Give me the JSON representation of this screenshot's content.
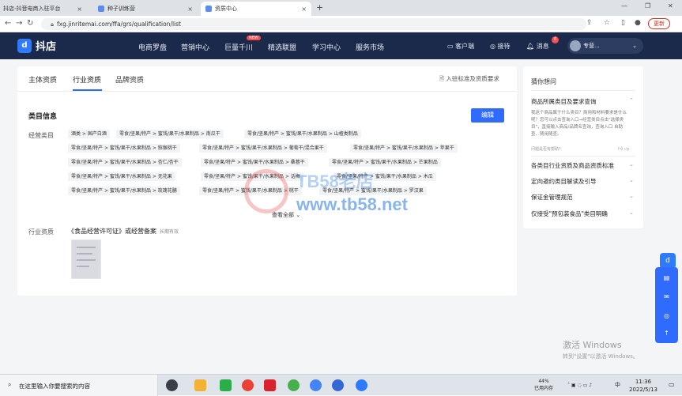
{
  "browser": {
    "tabs": [
      {
        "label": "抖店-抖音电商入驻平台",
        "active": false
      },
      {
        "label": "种子训练营",
        "active": false
      },
      {
        "label": "资质中心",
        "active": true
      }
    ],
    "url": "fxg.jinritemai.com/ffa/grs/qualification/list",
    "update_label": "更新"
  },
  "header": {
    "logo_text": "抖店",
    "nav": [
      "电商罗盘",
      "营销中心",
      "巨量千川",
      "精选联盟",
      "学习中心",
      "服务市场"
    ],
    "new_badge": "NEW",
    "right": [
      "客户端",
      "接待",
      "消息"
    ],
    "msg_count": "6",
    "user_name": "专营..."
  },
  "page": {
    "tabs": [
      "主体资质",
      "行业资质",
      "品牌资质"
    ],
    "active_tab": "行业资质",
    "req_link": "入驻标准及资质要求",
    "section_title": "类目信息",
    "edit_label": "编辑",
    "category_label": "经营类目",
    "categories": [
      "酒类 > 国产白酒",
      "零食/坚果/特产 > 蜜饯/果干/水果制品 > 南瓜干",
      "零食/坚果/特产 > 蜜饯/果干/水果制品 > 山楂类制品",
      "零食/坚果/特产 > 蜜饯/果干/水果制品 > 猕猴桃干",
      "零食/坚果/特产 > 蜜饯/果干/水果制品 > 葡萄干/混合果干",
      "零食/坚果/特产 > 蜜饯/果干/水果制品 > 苹果干",
      "零食/坚果/特产 > 蜜饯/果干/水果制品 > 杏仁/杏干",
      "零食/坚果/特产 > 蜜饯/果干/水果制品 > 桑葚干",
      "零食/坚果/特产 > 蜜饯/果干/水果制品 > 芒果制品",
      "零食/坚果/特产 > 蜜饯/果干/水果制品 > 无花果",
      "零食/坚果/特产 > 蜜饯/果干/水果制品 > 话梅",
      "零食/坚果/特产 > 蜜饯/果干/水果制品 > 木瓜",
      "零食/坚果/特产 > 蜜饯/果干/水果制品 > 玫瑰花脯",
      "零食/坚果/特产 > 蜜饯/果干/水果制品 > 桃干",
      "零食/坚果/特产 > 蜜饯/果干/水果制品 > 罗汉果"
    ],
    "view_all": "查看全部",
    "qual_label": "行业资质",
    "license_title": "《食品经营许可证》或经营备案",
    "license_valid": "长期有效"
  },
  "sidebar": {
    "title": "猜你想问",
    "items": [
      "商品所属类目及要求查询",
      "各类目行业资质及商品资质标准",
      "定向邀约类目解读及引导",
      "保证金管理规范",
      "仅接受\"预包装食品\"类目明确"
    ],
    "desc": "我这个商品属于什么类目？商用和材料要求是什么呢？您可以点击查询入口→经营类目点击\"选择类目\"，直接输入商品/品牌名查询，查询入口 自助查、随用随查。",
    "helpful": "问题是否有帮助？"
  },
  "watermark": {
    "line1": "TB58老店",
    "line2": "www.tb58.net"
  },
  "windows": {
    "activate_title": "激活 Windows",
    "activate_sub": "转到\"设置\"以激活 Windows。"
  },
  "taskbar": {
    "search_text": "在这里输入你要搜索的内容",
    "mem_pct": "44%",
    "mem_label": "已用内存",
    "time": "11:36",
    "date": "2022/5/13",
    "lang": "中"
  }
}
